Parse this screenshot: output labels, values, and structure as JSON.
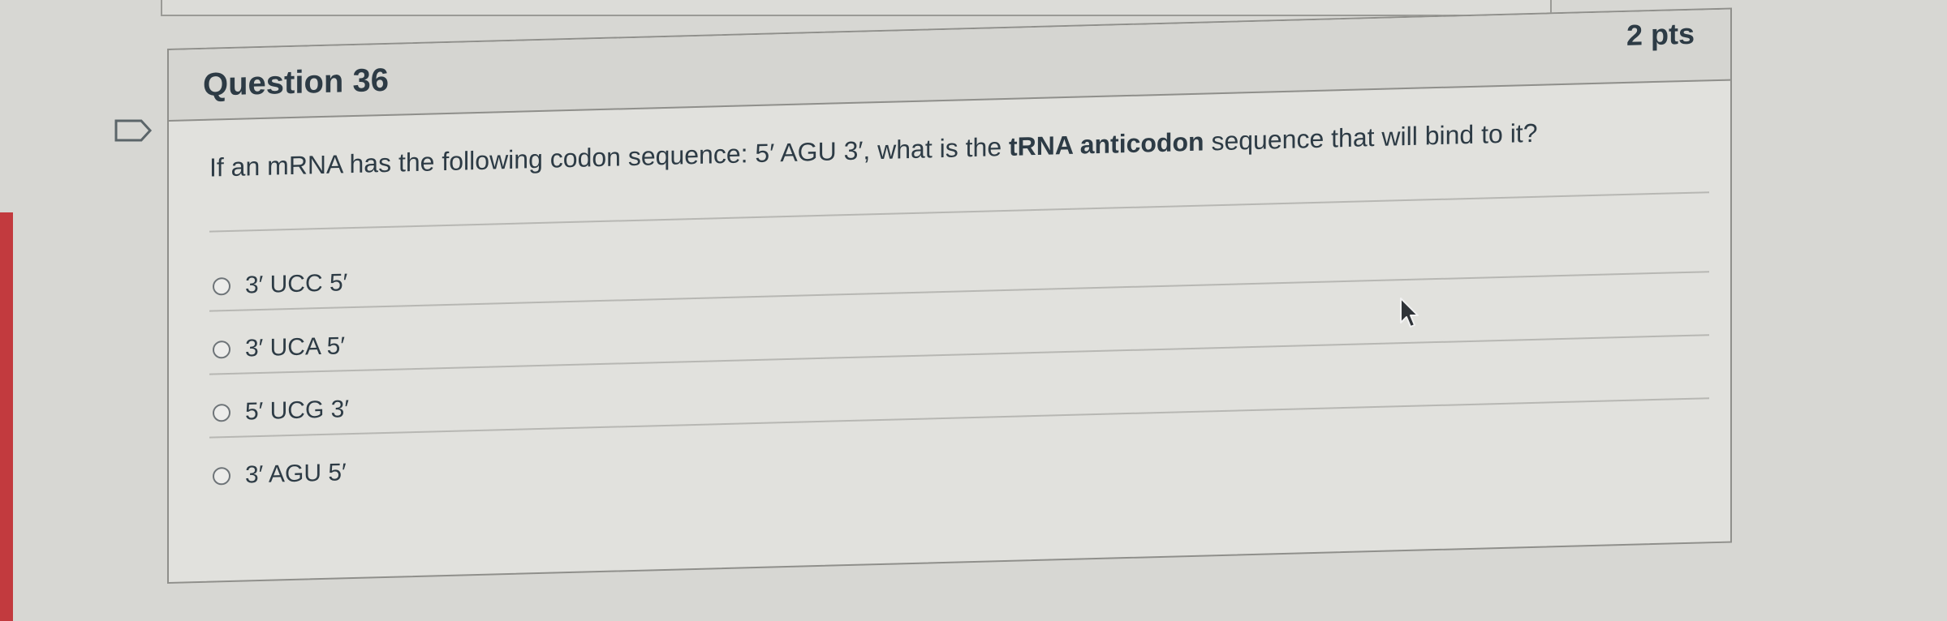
{
  "question": {
    "title": "Question 36",
    "points": "2 pts",
    "text_part1": "If an mRNA has the following codon sequence: 5′ AGU 3′, what is the ",
    "text_bold": "tRNA anticodon",
    "text_part2": " sequence that will bind to it?"
  },
  "answers": [
    {
      "label": "3′ UCC 5′",
      "selected": false
    },
    {
      "label": "3′ UCA 5′",
      "selected": false
    },
    {
      "label": "5′ UCG 3′",
      "selected": false
    },
    {
      "label": "3′ AGU 5′",
      "selected": false
    }
  ],
  "icons": {
    "flag": "flag-icon",
    "cursor": "mouse-pointer-icon"
  },
  "colors": {
    "text": "#2d3b45",
    "accent_red": "#c23a3e",
    "border": "#8f8f8b"
  }
}
